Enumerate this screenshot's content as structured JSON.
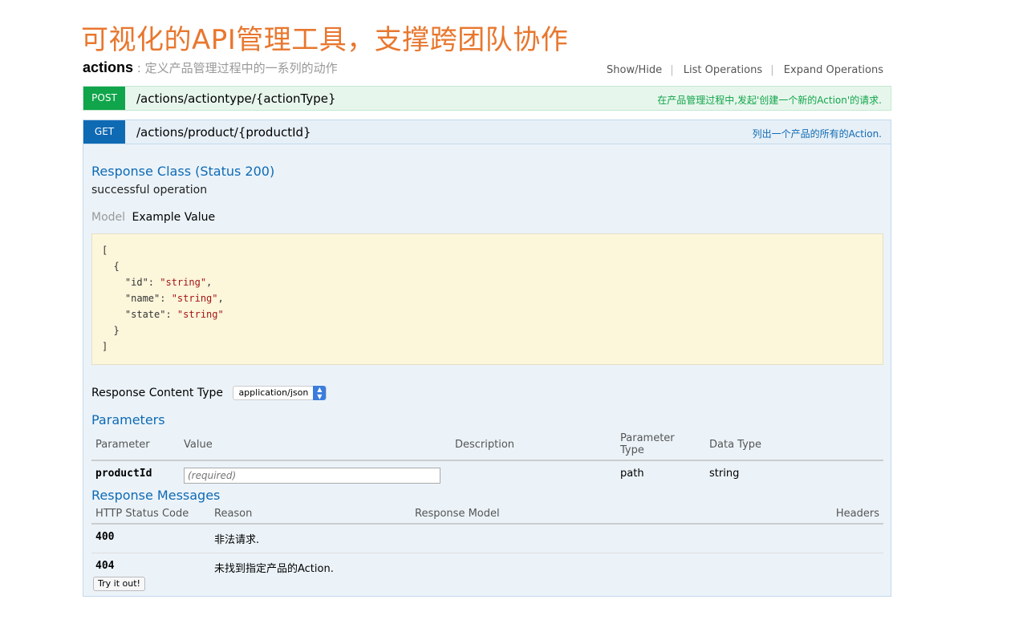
{
  "slide": {
    "title": "可视化的API管理工具，支撑跨团队协作"
  },
  "resource": {
    "name": "actions",
    "description": " : 定义产品管理过程中的一系列的动作",
    "actions": [
      "Show/Hide",
      "List Operations",
      "Expand Operations"
    ]
  },
  "operations": [
    {
      "method": "POST",
      "path": "/actions/actiontype/{actionType}",
      "summary": "在产品管理过程中,发起'创建一个新的Action'的请求.",
      "color": "#10a54a"
    },
    {
      "method": "GET",
      "path": "/actions/product/{productId}",
      "summary": "列出一个产品的所有的Action.",
      "color": "#0f6ab4"
    }
  ],
  "response_class": {
    "heading": "Response Class (Status 200)",
    "text": "successful operation"
  },
  "model_tabs": {
    "model": "Model",
    "example": "Example Value"
  },
  "example_value": {
    "line1": "[",
    "line2": "  {",
    "id_key": "    \"id\": ",
    "id_val": "\"string\"",
    "name_key": "    \"name\": ",
    "name_val": "\"string\"",
    "state_key": "    \"state\": ",
    "state_val": "\"string\"",
    "line6": "  }",
    "line7": "]"
  },
  "response_content_type": {
    "label": "Response Content Type",
    "selected": "application/json"
  },
  "parameters": {
    "heading": "Parameters",
    "headers": [
      "Parameter",
      "Value",
      "Description",
      "Parameter Type",
      "Data Type"
    ],
    "rows": [
      {
        "name": "productId",
        "placeholder": "(required)",
        "description": "",
        "param_type": "path",
        "data_type": "string"
      }
    ]
  },
  "response_messages": {
    "heading": "Response Messages",
    "headers": [
      "HTTP Status Code",
      "Reason",
      "Response Model",
      "Headers"
    ],
    "rows": [
      {
        "code": "400",
        "reason": "非法请求."
      },
      {
        "code": "404",
        "reason": "未找到指定产品的Action."
      }
    ]
  },
  "try_button": "Try it out!"
}
